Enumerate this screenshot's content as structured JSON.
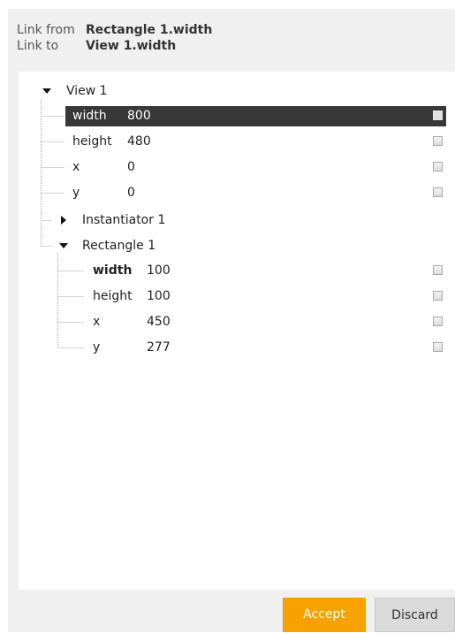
{
  "header": {
    "link_from_label": "Link from",
    "link_from_value": "Rectangle 1.width",
    "link_to_label": "Link to",
    "link_to_value": "View 1.width"
  },
  "tree": {
    "view": {
      "label": "View 1",
      "expanded": true,
      "properties": [
        {
          "name": "width",
          "value": "800",
          "selected": true
        },
        {
          "name": "height",
          "value": "480"
        },
        {
          "name": "x",
          "value": "0"
        },
        {
          "name": "y",
          "value": "0"
        }
      ]
    },
    "instantiator": {
      "label": "Instantiator 1",
      "expanded": false
    },
    "rectangle": {
      "label": "Rectangle 1",
      "expanded": true,
      "properties": [
        {
          "name": "width",
          "value": "100",
          "bold": true
        },
        {
          "name": "height",
          "value": "100"
        },
        {
          "name": "x",
          "value": "450"
        },
        {
          "name": "y",
          "value": "277"
        }
      ]
    }
  },
  "buttons": {
    "accept": "Accept",
    "discard": "Discard"
  },
  "colors": {
    "accent": "#f7a200",
    "selection": "#383838"
  },
  "icons": {
    "expand_open": "triangle-down-icon",
    "expand_closed": "triangle-right-icon",
    "checkbox": "checkbox-icon"
  }
}
